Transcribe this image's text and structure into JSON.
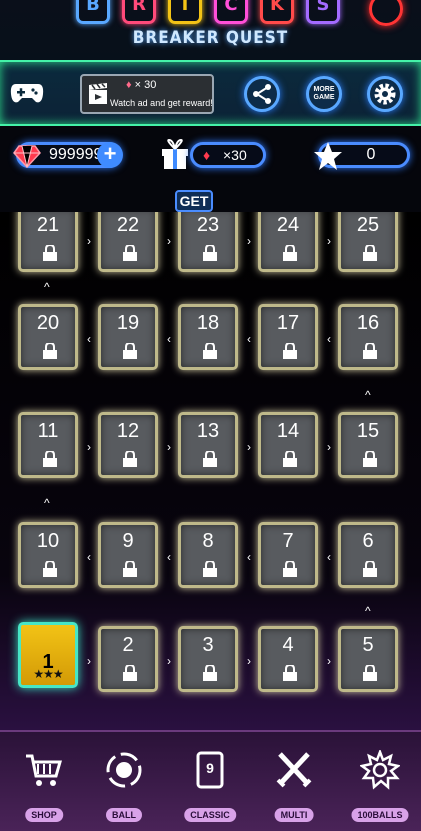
{
  "header": {
    "logo_letters": [
      "B",
      "R",
      "I",
      "C",
      "K",
      "S"
    ],
    "logo_colors": [
      "#59a8ff",
      "#ff4a7a",
      "#f2c316",
      "#ff4fd8",
      "#ff4a4a",
      "#a36bff"
    ],
    "subtitle": "BREAKER QUEST"
  },
  "toolbar": {
    "ad_reward": "× 30",
    "ad_text": "Watch ad and get reward!",
    "more_game_label": "MORE GAME"
  },
  "currency": {
    "gems": "999999",
    "gift_reward": "×30",
    "stars": "0",
    "get_label": "GET"
  },
  "levels": [
    {
      "num": "21"
    },
    {
      "num": "22"
    },
    {
      "num": "23"
    },
    {
      "num": "24"
    },
    {
      "num": "25"
    },
    {
      "num": "20"
    },
    {
      "num": "19"
    },
    {
      "num": "18"
    },
    {
      "num": "17"
    },
    {
      "num": "16"
    },
    {
      "num": "11"
    },
    {
      "num": "12"
    },
    {
      "num": "13"
    },
    {
      "num": "14"
    },
    {
      "num": "15"
    },
    {
      "num": "10"
    },
    {
      "num": "9"
    },
    {
      "num": "8"
    },
    {
      "num": "7"
    },
    {
      "num": "6"
    },
    {
      "num": "1",
      "stars": "★★★"
    },
    {
      "num": "2"
    },
    {
      "num": "3"
    },
    {
      "num": "4"
    },
    {
      "num": "5"
    }
  ],
  "nav": [
    {
      "label": "SHOP",
      "icon": "cart-icon"
    },
    {
      "label": "BALL",
      "icon": "ball-icon"
    },
    {
      "label": "CLASSIC",
      "icon": "classic-card-icon",
      "card_number": "9"
    },
    {
      "label": "MULTI",
      "icon": "crossed-swords-icon"
    },
    {
      "label": "100BALLS",
      "icon": "gear-burst-icon"
    }
  ]
}
